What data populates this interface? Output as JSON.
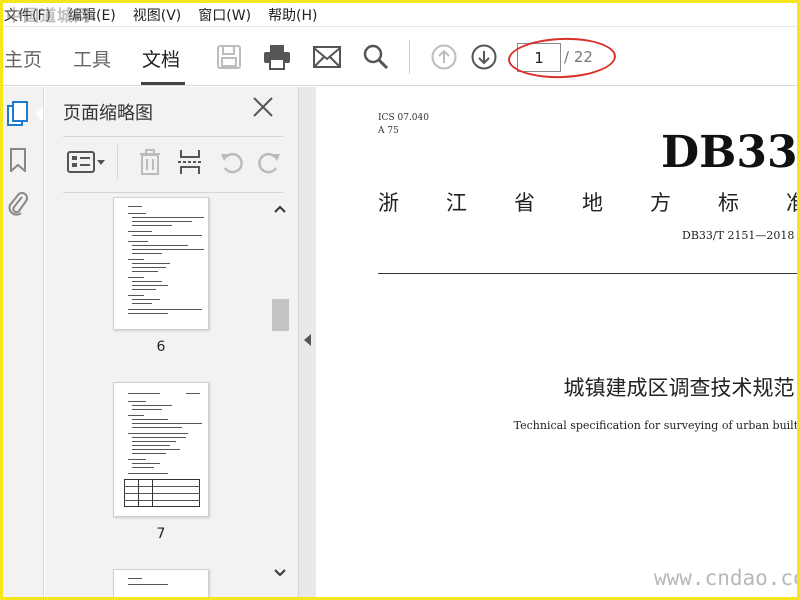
{
  "watermark_top": "中国道城网",
  "watermark_bottom": "www.cndao.com",
  "menu": [
    {
      "label": "文件(F)"
    },
    {
      "label": "编辑(E)"
    },
    {
      "label": "视图(V)"
    },
    {
      "label": "窗口(W)"
    },
    {
      "label": "帮助(H)"
    }
  ],
  "toolbar": {
    "tabs": [
      {
        "label": "主页"
      },
      {
        "label": "工具"
      },
      {
        "label": "文档",
        "active": true
      }
    ],
    "icons": [
      "save-icon",
      "print-icon",
      "mail-icon",
      "search-icon",
      "page-up-icon",
      "page-down-icon"
    ],
    "page_current": "1",
    "page_total": "/ 22",
    "highlight_color": "#d9302a"
  },
  "left_strip_icons": [
    "pages-icon",
    "bookmark-icon",
    "attachment-icon"
  ],
  "thumbnail_panel": {
    "title": "页面缩略图",
    "tools": [
      "page-options-icon",
      "delete-icon",
      "insert-page-icon",
      "rotate-ccw-icon",
      "rotate-cw-icon"
    ],
    "pages": [
      {
        "number": "6"
      },
      {
        "number": "7"
      }
    ]
  },
  "document": {
    "ics": "ICS 07.040",
    "ccs": "A 75",
    "db_mark": "DB33",
    "std_type_chars": [
      "浙",
      "江",
      "省",
      "地",
      "方",
      "标",
      "准"
    ],
    "std_code": "DB33/T 2151—2018",
    "title_cn": "城镇建成区调查技术规范",
    "title_en": "Technical specification for surveying of urban built-up area"
  }
}
